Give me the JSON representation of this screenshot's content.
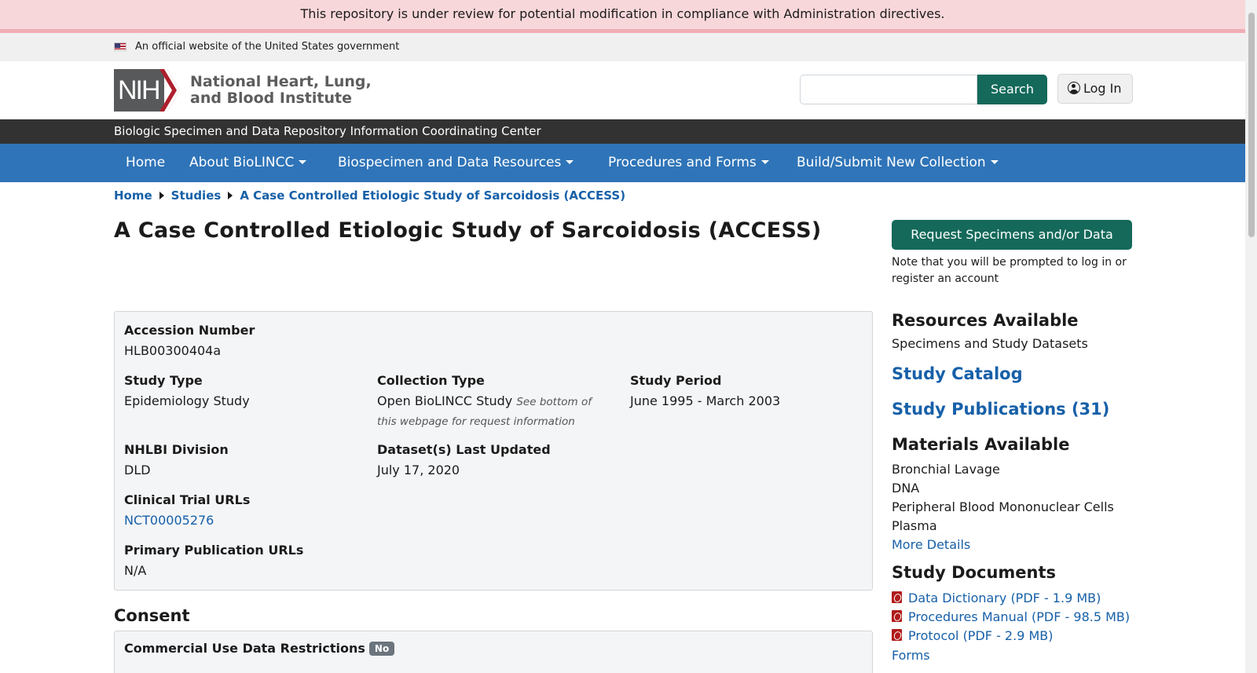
{
  "banner": {
    "text": "This repository is under review for potential modification in compliance with Administration directives."
  },
  "gov_banner": {
    "text": "An official website of the United States government",
    "icon": "us-flag-icon"
  },
  "header": {
    "logo_text": "NIH",
    "institute_line1": "National Heart, Lung,",
    "institute_line2": "and Blood Institute",
    "search": {
      "value": "",
      "placeholder": "",
      "button_label": "Search"
    },
    "login_label": "Log In",
    "login_icon": "user-circle-icon"
  },
  "subbar": {
    "text": "Biologic Specimen and Data Repository Information Coordinating Center"
  },
  "nav": {
    "items": [
      {
        "label": "Home"
      },
      {
        "label": "About BioLINCC"
      },
      {
        "label": "Biospecimen and Data Resources"
      },
      {
        "label": "Procedures and Forms"
      },
      {
        "label": "Build/Submit New Collection"
      }
    ]
  },
  "breadcrumb": {
    "items": [
      "Home",
      "Studies",
      "A Case Controlled Etiologic Study of Sarcoidosis (ACCESS)"
    ]
  },
  "page": {
    "title": "A Case Controlled Etiologic Study of Sarcoidosis (ACCESS)"
  },
  "details": {
    "accession_label": "Accession Number",
    "accession_value": "HLB00300404a",
    "study_type_label": "Study Type",
    "study_type_value": "Epidemiology Study",
    "collection_type_label": "Collection Type",
    "collection_type_value": "Open BioLINCC Study",
    "collection_type_note": "See bottom of this webpage for request information",
    "study_period_label": "Study Period",
    "study_period_value": "June 1995 - March 2003",
    "division_label": "NHLBI Division",
    "division_value": "DLD",
    "updated_label": "Dataset(s) Last Updated",
    "updated_value": "July 17, 2020",
    "trial_urls_label": "Clinical Trial URLs",
    "trial_urls_value": "NCT00005276",
    "pub_urls_label": "Primary Publication URLs",
    "pub_urls_value": "N/A"
  },
  "consent": {
    "heading": "Consent",
    "commercial_label": "Commercial Use Data Restrictions",
    "commercial_badge": "No"
  },
  "sidebar": {
    "request_button": "Request Specimens and/or Data",
    "request_note": "Note that you will be prompted to log in or register an account",
    "resources_heading": "Resources Available",
    "resources_text": "Specimens and Study Datasets",
    "catalog_link": "Study Catalog",
    "publications_link": "Study Publications (31)",
    "materials_heading": "Materials Available",
    "materials": [
      "Bronchial Lavage",
      "DNA",
      "Peripheral Blood Mononuclear Cells",
      "Plasma"
    ],
    "more_details": "More Details",
    "documents_heading": "Study Documents",
    "documents": [
      "Data Dictionary (PDF - 1.9 MB)",
      "Procedures Manual (PDF - 98.5 MB)",
      "Protocol (PDF - 2.9 MB)"
    ],
    "forms_link": "Forms"
  },
  "colors": {
    "primary_green": "#14695a",
    "nav_blue": "#2f74b8",
    "link_blue": "#1760a8",
    "banner_pink": "#f8d7da"
  }
}
